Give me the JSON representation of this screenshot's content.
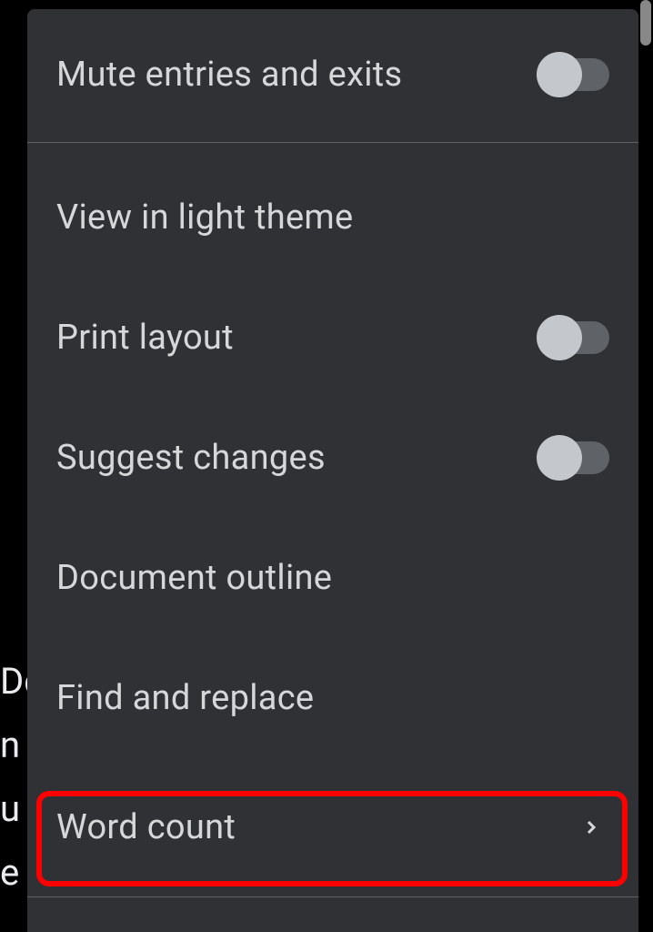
{
  "menu": {
    "items": [
      {
        "label": "Mute entries and exits",
        "has_toggle": true,
        "toggle_state": false
      },
      {
        "label": "View in light theme",
        "has_toggle": false
      },
      {
        "label": "Print layout",
        "has_toggle": true,
        "toggle_state": false
      },
      {
        "label": "Suggest changes",
        "has_toggle": true,
        "toggle_state": false
      },
      {
        "label": "Document outline",
        "has_toggle": false
      },
      {
        "label": "Find and replace",
        "has_toggle": false
      },
      {
        "label": "Word count",
        "has_toggle": false,
        "has_chevron": true
      }
    ]
  },
  "background": {
    "partial_chars": [
      "Dc",
      "n",
      "u",
      "e"
    ]
  }
}
